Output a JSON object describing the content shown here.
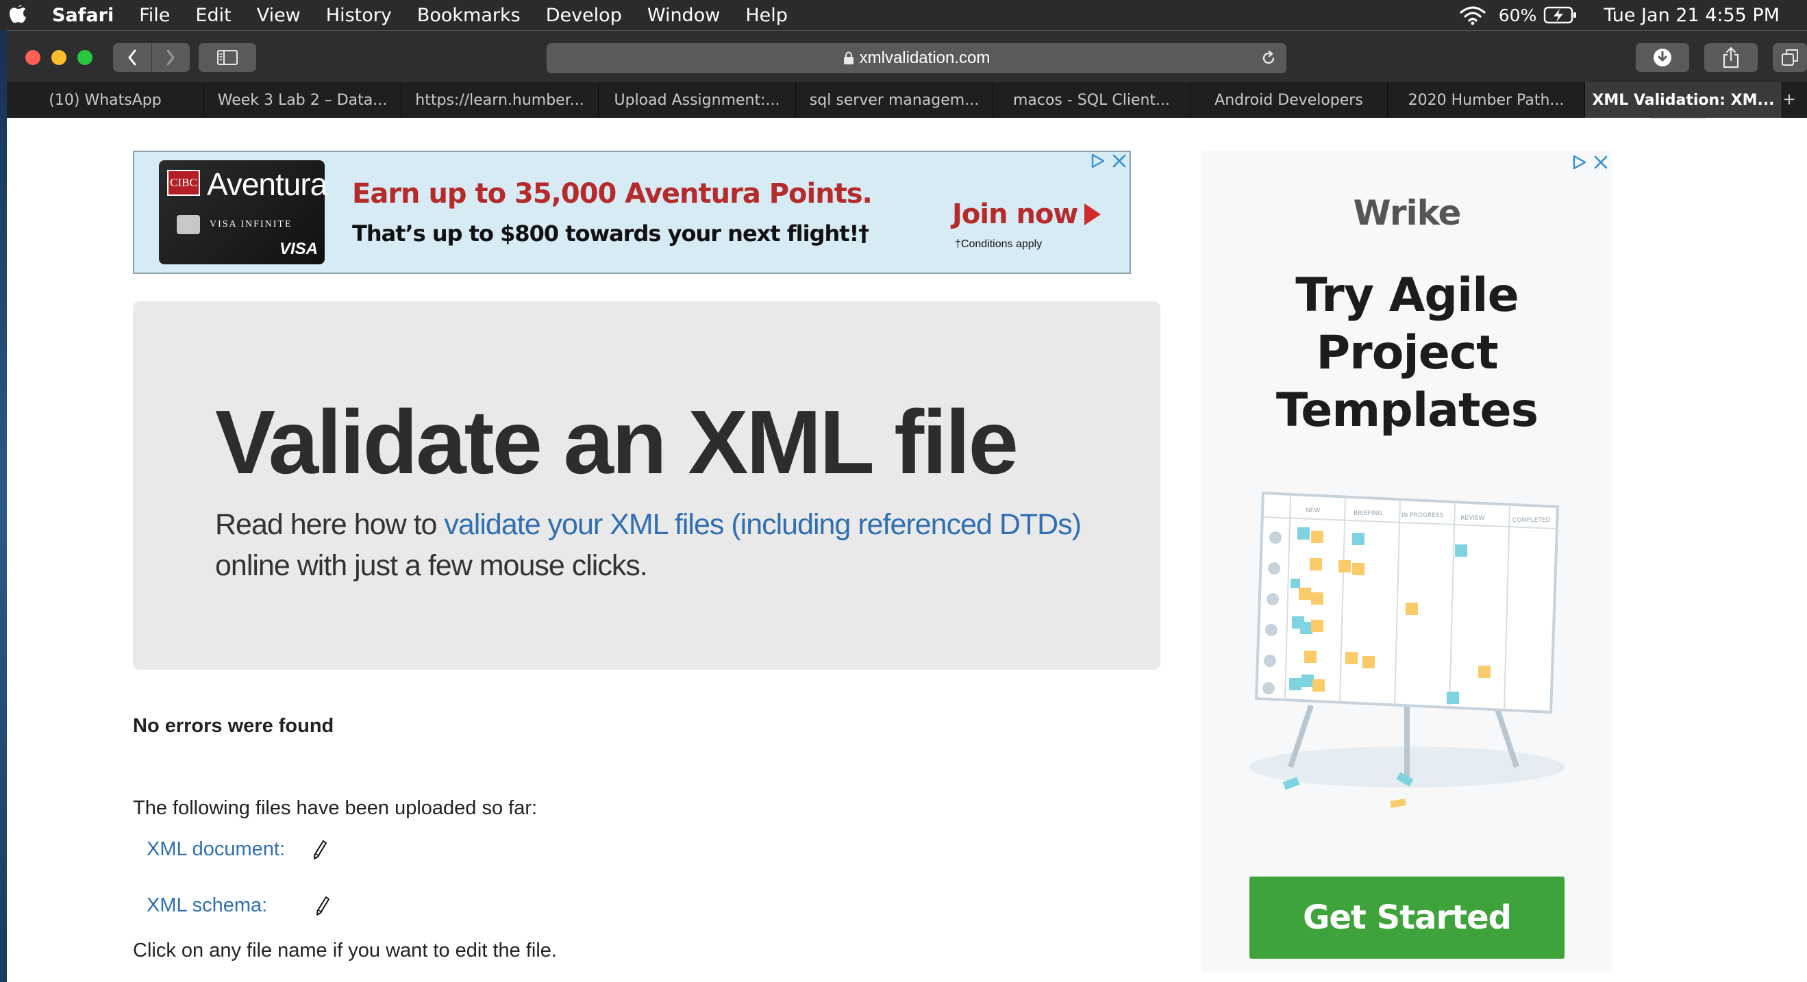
{
  "menubar": {
    "app_name": "Safari",
    "menus": [
      "File",
      "Edit",
      "View",
      "History",
      "Bookmarks",
      "Develop",
      "Window",
      "Help"
    ],
    "battery_percent": "60%",
    "clock": "Tue Jan 21  4:55 PM"
  },
  "toolbar": {
    "url": "xmlvalidation.com"
  },
  "tabs": [
    {
      "label": "(10) WhatsApp"
    },
    {
      "label": "Week 3 Lab 2 – Data..."
    },
    {
      "label": "https://learn.humber..."
    },
    {
      "label": "Upload Assignment:..."
    },
    {
      "label": "sql server managem..."
    },
    {
      "label": "macos - SQL Client..."
    },
    {
      "label": "Android Developers"
    },
    {
      "label": "2020 Humber Path..."
    },
    {
      "label": "XML Validation: XM..."
    }
  ],
  "tab_add": "+",
  "ad_banner": {
    "logo": "CIBC",
    "card_brand": "Aventura",
    "card_tier": "VISA INFINITE",
    "card_network": "VISA",
    "headline": "Earn up to 35,000 Aventura Points.",
    "subline": "That’s up to $800 towards your next flight!†",
    "cta": "Join now",
    "conditions": "†Conditions apply",
    "accent_color": "#b52a2a"
  },
  "hero": {
    "title": "Validate an XML file",
    "desc_prefix": "Read here how to ",
    "desc_link": "validate your XML files (including referenced DTDs)",
    "desc_suffix": " online with just a few mouse clicks."
  },
  "results": {
    "status": "No errors were found",
    "uploaded_intro": "The following files have been uploaded so far:",
    "files": [
      {
        "label": "XML document:"
      },
      {
        "label": "XML schema:"
      }
    ],
    "hint": "Click on any file name if you want to edit the file."
  },
  "side_ad": {
    "brand": "Wrike",
    "heading_lines": [
      "Try Agile",
      "Project",
      "Templates"
    ],
    "board_columns": [
      "NEW",
      "BRIEFING",
      "IN PROGRESS",
      "REVIEW",
      "COMPLETED"
    ],
    "cta": "Get Started",
    "cta_color": "#3fa33b"
  },
  "colors": {
    "link": "#2f6fb2",
    "hero_bg": "#e9e9e9",
    "toolbar_bg": "#2e2e30"
  }
}
